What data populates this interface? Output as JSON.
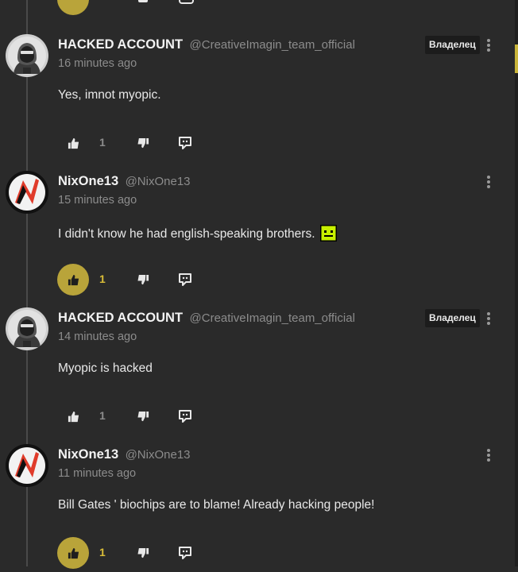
{
  "comments": [
    {
      "username": "HACKED ACCOUNT",
      "handle": "@CreativeImagin_team_official",
      "time": "16 minutes ago",
      "badge": "Владелец",
      "text": "Yes, imnot myopic.",
      "likes": "1",
      "liked": false,
      "avatar": "hacker-avatar"
    },
    {
      "username": "NixOne13",
      "handle": "@NixOne13",
      "time": "15 minutes ago",
      "badge": "",
      "text": "I didn't know he had english-speaking brothers.",
      "likes": "1",
      "liked": true,
      "avatar": "nix-avatar",
      "emoji": "neutral-face-emoji"
    },
    {
      "username": "HACKED ACCOUNT",
      "handle": "@CreativeImagin_team_official",
      "time": "14 minutes ago",
      "badge": "Владелец",
      "text": "Myopic is hacked",
      "likes": "1",
      "liked": false,
      "avatar": "hacker-avatar"
    },
    {
      "username": "NixOne13",
      "handle": "@NixOne13",
      "time": "11 minutes ago",
      "badge": "",
      "text": "Bill Gates ' biochips are to blame! Already hacking people!",
      "likes": "1",
      "liked": true,
      "avatar": "nix-avatar"
    }
  ],
  "colors": {
    "accent": "#b9a43a",
    "background": "#2a2a2a",
    "muted": "#8c8c8c"
  },
  "icons": {
    "like": "thumbs-up-icon",
    "dislike": "thumbs-down-icon",
    "reply": "reply-icon",
    "menu": "more-vertical-icon"
  }
}
